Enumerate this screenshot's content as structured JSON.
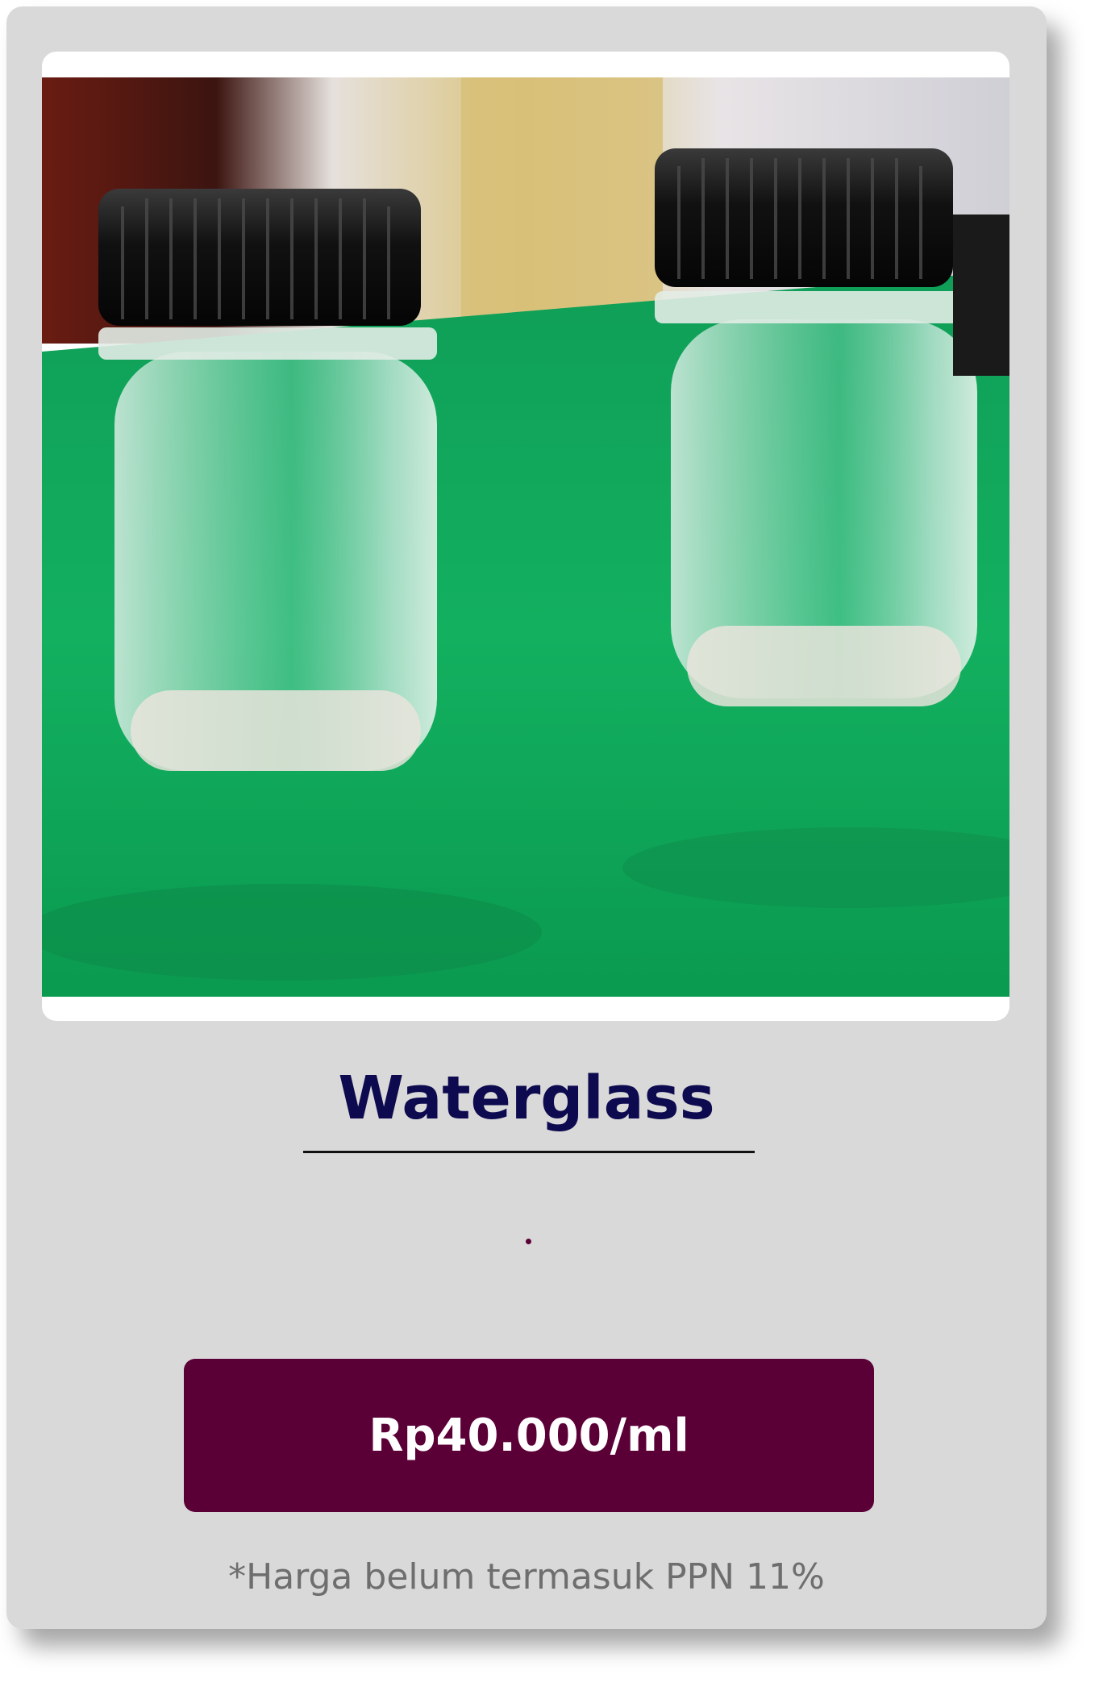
{
  "product": {
    "image_alt": "Waterglass product photo",
    "name": "Waterglass",
    "separator_glyph": "",
    "price_label": "Rp40.000/ml",
    "price_note": "*Harga belum termasuk PPN 11%"
  },
  "colors": {
    "card_background": "#d9d9d9",
    "title_color": "#0d0a4f",
    "button_background": "#5b0037",
    "button_text": "#ffffff",
    "note_text": "#6e6e6e"
  }
}
